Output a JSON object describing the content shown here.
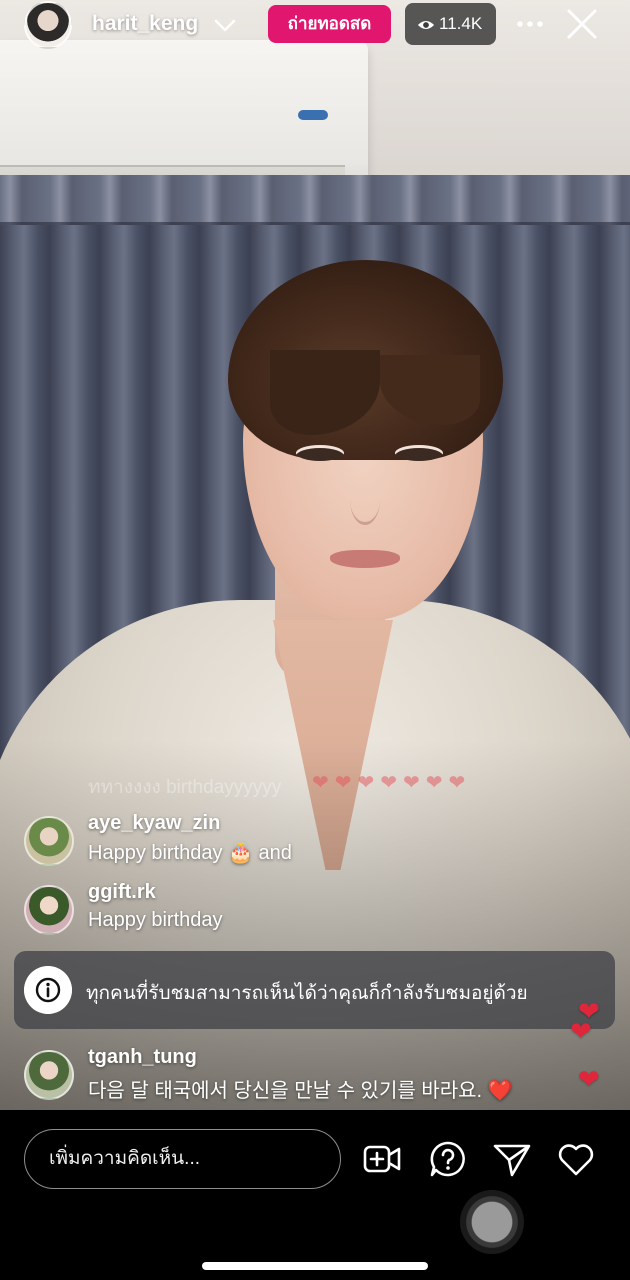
{
  "header": {
    "username": "harit_keng",
    "live_label": "ถ่ายทอดสด",
    "viewer_count": "11.4K",
    "colors": {
      "live_badge": "#e1166e",
      "viewer_badge": "#3c3c3c"
    }
  },
  "comments": {
    "faded": {
      "user": "ททางงงง birthdayyyyyy",
      "hearts": "❤❤❤❤❤❤❤"
    },
    "items": [
      {
        "user": "aye_kyaw_zin",
        "text": "Happy birthday 🎂 and"
      },
      {
        "user": "ggift.rk",
        "text": "Happy birthday"
      },
      {
        "user": "tganh_tung",
        "text": "다음 달 태국에서 당신을 만날 수 있기를 바라요. ❤️"
      }
    ]
  },
  "info_banner": {
    "text": "ทุกคนที่รับชมสามารถเห็นได้ว่าคุณก็กำลังรับชมอยู่ด้วย",
    "icon": "info-icon"
  },
  "floating_hearts": {
    "icon": "heart-icon",
    "color": "#e0263a"
  },
  "bottom_bar": {
    "comment_placeholder": "เพิ่มความคิดเห็น...",
    "icons": [
      "video-add-icon",
      "question-icon",
      "send-icon",
      "heart-icon"
    ]
  }
}
